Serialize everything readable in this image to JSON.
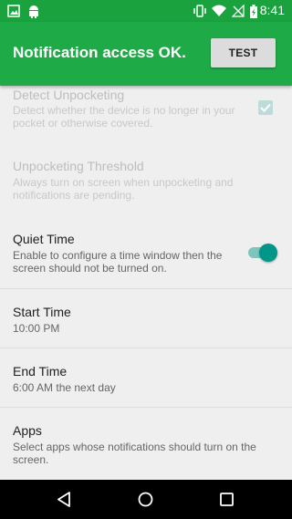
{
  "status_bar": {
    "time": "8:41",
    "icons": [
      "image-icon",
      "android-icon",
      "vibrate-icon",
      "wifi-icon",
      "no-signal-icon",
      "battery-charging-icon"
    ]
  },
  "banner": {
    "title": "Notification access OK.",
    "test_button_label": "TEST"
  },
  "preferences": [
    {
      "title": "Detect Unpocketing",
      "summary": "Detect whether the device is no longer in your pocket or otherwise covered.",
      "enabled": false,
      "control": "checkbox",
      "checked": true
    },
    {
      "title": "Unpocketing Threshold",
      "summary": "Always turn on screen when unpocketing and notifications are pending.",
      "enabled": false
    },
    {
      "title": "Quiet Time",
      "summary": "Enable to configure a time window then the screen should not be turned on.",
      "enabled": true,
      "control": "switch",
      "checked": true
    },
    {
      "title": "Start Time",
      "summary": "10:00 PM",
      "enabled": true
    },
    {
      "title": "End Time",
      "summary": "6:00 AM the next day",
      "enabled": true
    },
    {
      "title": "Apps",
      "summary": "Select apps whose notifications should turn on the screen.",
      "enabled": true
    }
  ],
  "nav_bar": {
    "buttons": [
      "back-icon",
      "home-icon",
      "recents-icon"
    ]
  },
  "colors": {
    "status_bar": "#19a23d",
    "banner": "#1faa48",
    "accent": "#009688",
    "background": "#efefef"
  }
}
